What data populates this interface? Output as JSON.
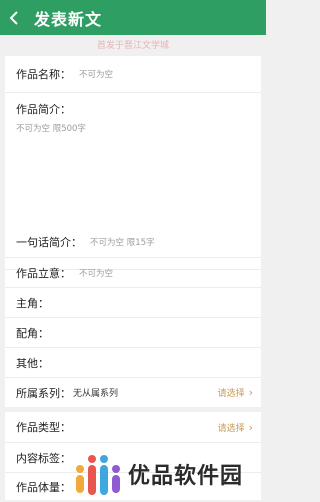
{
  "header": {
    "back_icon": "chevron-left-icon",
    "title": "发表新文"
  },
  "notice": "首发于晋江文学城",
  "form": {
    "work_name": {
      "label": "作品名称：",
      "placeholder": "不可为空"
    },
    "intro": {
      "label": "作品简介：",
      "placeholder": "不可为空 限500字"
    },
    "one_line": {
      "label": "一句话简介：",
      "placeholder": "不可为空 限15字"
    },
    "concept": {
      "label": "作品立意：",
      "placeholder": "不可为空"
    },
    "lead": {
      "label": "主角："
    },
    "supporting": {
      "label": "配角："
    },
    "other": {
      "label": "其他："
    },
    "series": {
      "label": "所属系列：",
      "value": "无从属系列",
      "action": "请选择",
      "action_icon": "chevron-right-icon"
    },
    "type": {
      "label": "作品类型：",
      "action": "请选择",
      "action_icon": "chevron-right-icon"
    },
    "tags": {
      "label": "内容标签："
    },
    "size": {
      "label": "作品体量："
    }
  },
  "watermark": {
    "text": "优品软件园",
    "colors": [
      "#f2a93b",
      "#e9554f",
      "#3fa7e0",
      "#8e5bd0"
    ]
  },
  "colors": {
    "brand_green": "#2f9e63",
    "action_gold": "#c89a52",
    "notice_pink": "#e7b4b4"
  }
}
